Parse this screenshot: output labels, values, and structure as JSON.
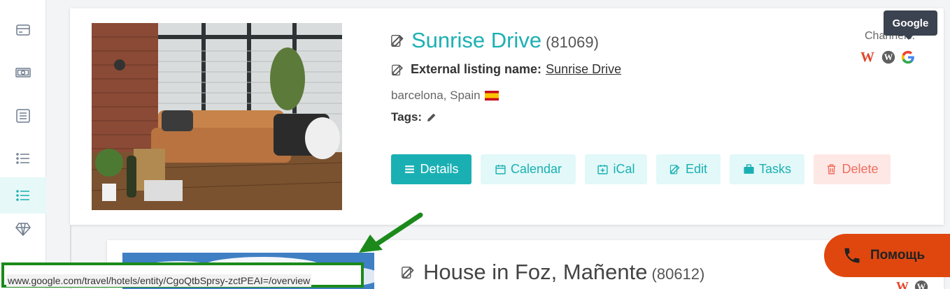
{
  "sidebar": {
    "items": [
      {
        "icon": "card-icon",
        "active": false
      },
      {
        "icon": "money-icon",
        "active": false
      },
      {
        "icon": "list-box-icon",
        "active": false
      },
      {
        "icon": "bullet-list-icon",
        "active": false
      },
      {
        "icon": "bullet-list-icon",
        "active": true
      },
      {
        "icon": "diamond-icon",
        "active": false
      }
    ]
  },
  "listings": [
    {
      "name": "Sunrise Drive",
      "id": "(81069)",
      "external_label": "External listing name:",
      "external_name": "Sunrise Drive",
      "location": "barcelona, Spain",
      "tags_label": "Tags:",
      "buttons": {
        "details": "Details",
        "calendar": "Calendar",
        "ical": "iCal",
        "edit": "Edit",
        "tasks": "Tasks",
        "delete": "Delete"
      },
      "channels_label": "Channels:",
      "channels": [
        "W",
        "wordpress-icon",
        "google-icon"
      ]
    },
    {
      "name": "House in Foz, Mañente",
      "id": "(80612)",
      "channels": [
        "W",
        "wordpress-icon"
      ]
    }
  ],
  "tooltip": "Google",
  "help_button": "Помощь",
  "status_url": "www.google.com/travel/hotels/entity/CgoQtbSprsy-zctPEAI=/overview",
  "colors": {
    "accent": "#1ab0b3",
    "danger": "#ef6e5e",
    "help": "#e0470f",
    "annotation": "#1b8a1b"
  }
}
